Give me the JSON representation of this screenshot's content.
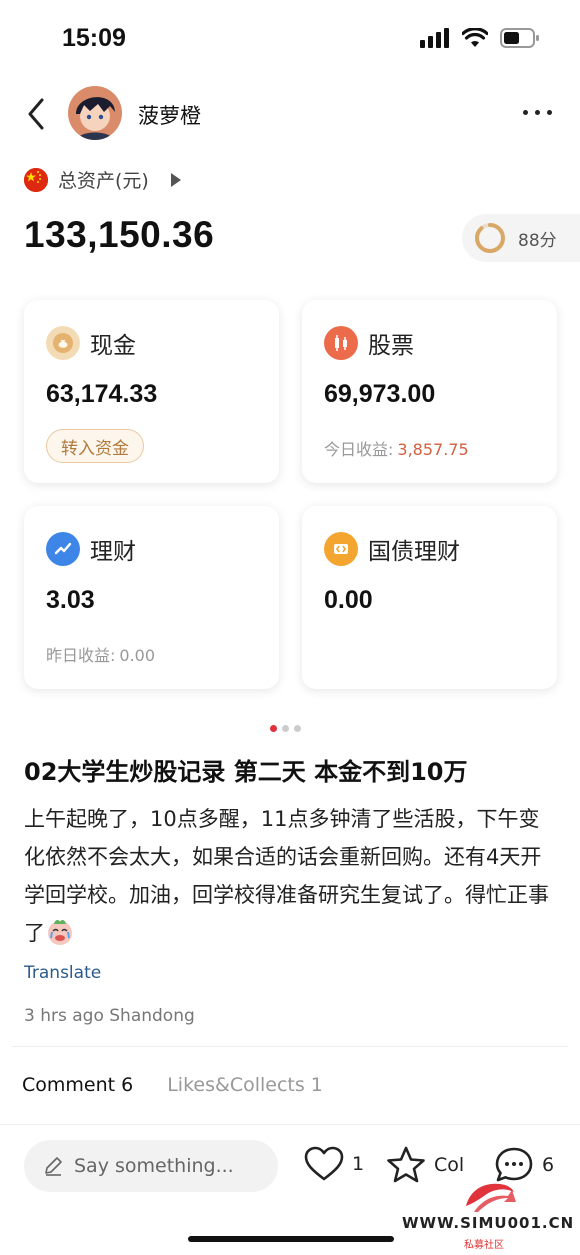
{
  "status_bar": {
    "time": "15:09"
  },
  "header": {
    "username": "菠萝橙"
  },
  "assets": {
    "label": "总资产(元)",
    "total": "133,150.36",
    "score": "88分",
    "score_fraction": 0.88
  },
  "cards": [
    {
      "title": "现金",
      "value": "63,174.33",
      "button": "转入资金",
      "icon": "cash-icon",
      "color": "#e5b36f"
    },
    {
      "title": "股票",
      "value": "69,973.00",
      "sub_label": "今日收益:",
      "sub_value": "3,857.75",
      "icon": "candlestick-icon",
      "color": "#ec6b4b"
    },
    {
      "title": "理财",
      "value": "3.03",
      "sub_label": "昨日收益:",
      "sub_value": "0.00",
      "icon": "trend-icon",
      "color": "#3d86e8"
    },
    {
      "title": "国债理财",
      "value": "0.00",
      "icon": "bond-icon",
      "color": "#f3a530"
    }
  ],
  "pager": {
    "count": 3,
    "active": 0
  },
  "post": {
    "title": "02大学生炒股记录 第二天 本金不到10万",
    "body": "上午起晚了，10点多醒，11点多钟清了些活股，下午变化依然不会太大，如果合适的话会重新回购。还有4天开学回学校。加油，回学校得准备研究生复试了。得忙正事了",
    "translate": "Translate",
    "meta": "3 hrs ago Shandong"
  },
  "tabs": [
    {
      "label": "Comment 6",
      "active": true
    },
    {
      "label": "Likes&Collects 1",
      "active": false
    }
  ],
  "bottom_bar": {
    "placeholder": "Say something...",
    "likes": "1",
    "collect_label": "Col",
    "comments": "6"
  },
  "watermark": {
    "text": "WWW.SIMU001.CN",
    "sub": "私募社区"
  }
}
